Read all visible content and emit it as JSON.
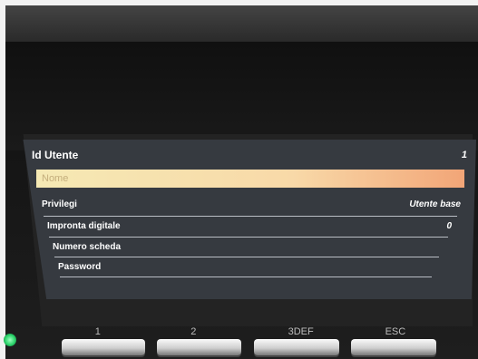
{
  "screen": {
    "header": {
      "label": "Id Utente",
      "value": "1"
    },
    "fields": [
      {
        "label": "Nome",
        "value": ""
      },
      {
        "label": "Privilegi",
        "value": "Utente base"
      },
      {
        "label": "Impronta digitale",
        "value": "0"
      },
      {
        "label": "Numero scheda",
        "value": ""
      },
      {
        "label": "Password",
        "value": ""
      }
    ],
    "selected_index": 0
  },
  "keypad": {
    "keys": [
      {
        "label": "1"
      },
      {
        "label": "2"
      },
      {
        "label": "3DEF"
      },
      {
        "label": "ESC"
      }
    ]
  },
  "colors": {
    "screen_bg": "#363a40",
    "highlight": "#f5e9b4",
    "status_led": "#2bd36a"
  }
}
